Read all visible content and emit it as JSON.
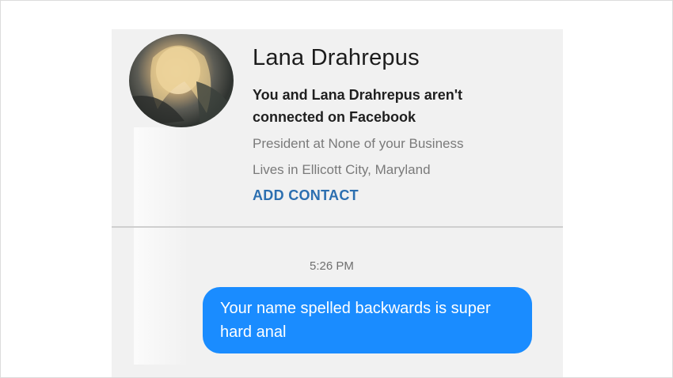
{
  "contact": {
    "name": "Lana Drahrepus",
    "connection_notice": "You and Lana Drahrepus aren't connected on Facebook",
    "work": "President at None of your Business",
    "location": "Lives in Ellicott City, Maryland",
    "add_contact_label": "ADD CONTACT",
    "avatar_icon": "profile-photo"
  },
  "conversation": {
    "timestamp": "5:26 PM",
    "messages": [
      {
        "text": "Your name spelled backwards is super hard anal",
        "sender": "me"
      }
    ]
  },
  "colors": {
    "bubble": "#1a8cff",
    "link": "#2c6fb0",
    "background": "#f1f1f1"
  }
}
